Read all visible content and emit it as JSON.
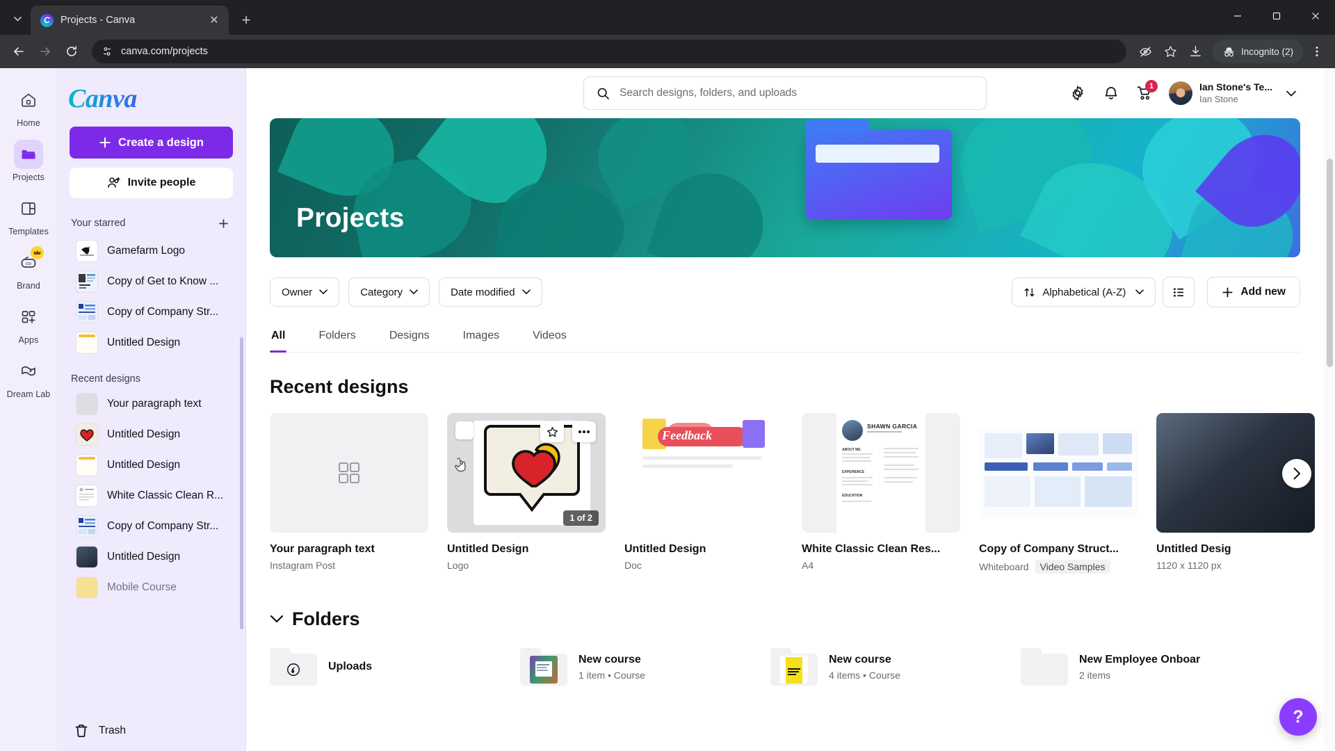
{
  "browser": {
    "tab": {
      "title": "Projects - Canva",
      "favicon": "canva-logo-icon",
      "close_label": "✕"
    },
    "new_tab_label": "+",
    "tab_list_icon": "chevron-down-icon",
    "url": "canva.com/projects",
    "back_icon": "back-arrow-icon",
    "forward_icon": "forward-arrow-icon",
    "reload_icon": "reload-icon",
    "site_info_icon": "page-settings-icon",
    "tracking_icon": "eye-off-icon",
    "bookmark_icon": "star-icon",
    "download_icon": "download-icon",
    "incognito_label": "Incognito (2)",
    "menu_icon": "three-dot-menu-icon",
    "minimize_label": "—",
    "maximize_label": "❐",
    "close_label": "✕"
  },
  "rail": {
    "items": [
      {
        "label": "Home",
        "icon": "home-icon",
        "active": false,
        "badge": ""
      },
      {
        "label": "Projects",
        "icon": "folder-icon",
        "active": true,
        "badge": ""
      },
      {
        "label": "Templates",
        "icon": "template-icon",
        "active": false,
        "badge": ""
      },
      {
        "label": "Brand",
        "icon": "brand-icon",
        "active": false,
        "badge": "crown-icon"
      },
      {
        "label": "Apps",
        "icon": "apps-grid-icon",
        "active": false,
        "badge": ""
      },
      {
        "label": "Dream Lab",
        "icon": "dream-lab-icon",
        "active": false,
        "badge": ""
      }
    ]
  },
  "sidebar": {
    "logo": "Canva",
    "create_button": "Create a design",
    "create_icon": "plus-icon",
    "invite_button": "Invite people",
    "invite_icon": "add-people-icon",
    "starred_heading": "Your starred",
    "starred_add_icon": "plus-icon",
    "starred": [
      {
        "label": "Gamefarm Logo",
        "thumb": "logo-thumb"
      },
      {
        "label": "Copy of Get to Know ...",
        "thumb": "doc-thumb"
      },
      {
        "label": "Copy of Company Str...",
        "thumb": "whiteboard-thumb"
      },
      {
        "label": "Untitled Design",
        "thumb": "blank-thumb"
      }
    ],
    "recent_heading": "Recent designs",
    "recent": [
      {
        "label": "Your paragraph text",
        "thumb": "gray-thumb"
      },
      {
        "label": "Untitled Design",
        "thumb": "heart-thumb"
      },
      {
        "label": "Untitled Design",
        "thumb": "blank-thumb"
      },
      {
        "label": "White Classic Clean R...",
        "thumb": "resume-thumb"
      },
      {
        "label": "Copy of Company Str...",
        "thumb": "whiteboard-thumb"
      },
      {
        "label": "Untitled Design",
        "thumb": "photo-thumb"
      },
      {
        "label": "Mobile Course",
        "thumb": "course-thumb"
      }
    ],
    "trash_label": "Trash",
    "trash_icon": "trash-icon"
  },
  "search": {
    "placeholder": "Search designs, folders, and uploads",
    "value": "",
    "icon": "search-icon"
  },
  "topbar": {
    "settings_icon": "gear-icon",
    "notifications_icon": "bell-icon",
    "cart_icon": "cart-icon",
    "cart_badge": "1",
    "account_name": "Ian Stone's Te...",
    "account_sub": "Ian Stone",
    "account_chevron": "chevron-down-icon"
  },
  "hero": {
    "title": "Projects"
  },
  "filters": {
    "owner": "Owner",
    "category": "Category",
    "date": "Date modified",
    "chevron": "chevron-down-icon",
    "sort_label": "Alphabetical (A-Z)",
    "sort_icon": "sort-arrows-icon",
    "view_icon": "list-view-icon",
    "add_new": "Add new",
    "add_new_icon": "plus-icon"
  },
  "tabs": [
    {
      "label": "All",
      "active": true
    },
    {
      "label": "Folders",
      "active": false
    },
    {
      "label": "Designs",
      "active": false
    },
    {
      "label": "Images",
      "active": false
    },
    {
      "label": "Videos",
      "active": false
    }
  ],
  "recent_section": {
    "title": "Recent designs",
    "next_icon": "chevron-right-icon",
    "cards": [
      {
        "name": "Your paragraph text",
        "meta": "Instagram Post",
        "badge": "",
        "thumb": "placeholder-grid",
        "hovered": false,
        "page_count": ""
      },
      {
        "name": "Untitled Design",
        "meta": "Logo",
        "badge": "",
        "thumb": "heart-speech-bubble",
        "hovered": true,
        "page_count": "1 of 2",
        "star_icon": "star-icon",
        "more_icon": "three-dot-icon",
        "checkbox": "selection-checkbox"
      },
      {
        "name": "Untitled Design",
        "meta": "Doc",
        "badge": "",
        "thumb": "feedback-doc",
        "hovered": false,
        "page_count": ""
      },
      {
        "name": "White Classic Clean Res...",
        "meta": "A4",
        "badge": "",
        "thumb": "resume-shawn-garcia",
        "hovered": false,
        "page_count": ""
      },
      {
        "name": "Copy of Company Struct...",
        "meta": "Whiteboard",
        "badge": "Video Samples",
        "thumb": "whiteboard-chart",
        "hovered": false,
        "page_count": ""
      },
      {
        "name": "Untitled Desig",
        "meta": "1120 x 1120 px",
        "badge": "",
        "thumb": "dark-photo",
        "hovered": false,
        "page_count": ""
      }
    ]
  },
  "folders_section": {
    "title": "Folders",
    "collapse_icon": "chevron-down-icon",
    "items": [
      {
        "name": "Uploads",
        "sub": "",
        "thumb": "uploads-cloud"
      },
      {
        "name": "New course",
        "sub": "1 item • Course",
        "thumb": "course-photo"
      },
      {
        "name": "New course",
        "sub": "4 items • Course",
        "thumb": "yellow-poster"
      },
      {
        "name": "New Employee Onboar",
        "sub": "2 items",
        "thumb": "empty-folder"
      }
    ]
  },
  "help": {
    "label": "?"
  },
  "colors": {
    "brand_purple": "#7d2ae8",
    "sidebar_bg": "#efeafc",
    "badge_red": "#d6254a",
    "accent_teal": "#00c4cc"
  }
}
